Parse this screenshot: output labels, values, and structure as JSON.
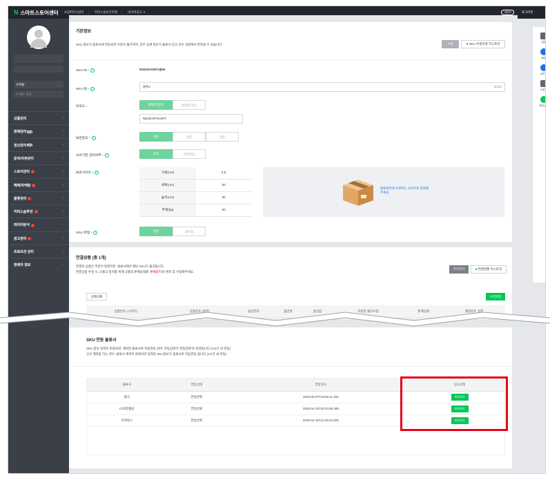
{
  "topbar": {
    "logo": "N",
    "title": "스마트스토어센터",
    "nav": [
      "쇼핑파트너센터",
      "커머스솔루션마켓",
      "네이버광고"
    ],
    "nav_suffix": "▾",
    "user_badge": "내정보",
    "logout": "로그아웃"
  },
  "sidebar": {
    "store_select": "수퍼왕",
    "search_placeholder": "메뉴 검색",
    "items": [
      {
        "label": "상품관리"
      },
      {
        "label": "판매관리",
        "badge": "pay"
      },
      {
        "label": "정산관리",
        "badge": "pay"
      },
      {
        "label": "문의/리뷰관리"
      },
      {
        "label": "스토어관리",
        "new": true
      },
      {
        "label": "혜택/마케팅",
        "new": true
      },
      {
        "label": "물류관리",
        "new": true
      },
      {
        "label": "커머스솔루션",
        "new": true
      },
      {
        "label": "데이터분석",
        "new": true
      },
      {
        "label": "광고관리",
        "new": true
      },
      {
        "label": "프로모션 관리"
      },
      {
        "label": "판매자 정보"
      }
    ],
    "pay_text": "pay"
  },
  "basic": {
    "title": "기본정보",
    "desc": "SKU 정보가 물류사에 연동되면 수정이 불가하며, 일부 상세 정보가 물류사 입고 검수 과정에서 변경될 수 있습니다.",
    "btn_edit": "수정",
    "btn_history": "SKU 수정이력 히스토리",
    "sku_id_label": "SKU ID",
    "sku_id_value": "N31GKXWVJjbN",
    "sku_name_label": "SKU 명",
    "sku_name_value": "블루J",
    "sku_name_count": "2/150",
    "barcode_label": "바코드",
    "barcode_tabs": [
      "판매자 입력",
      "네이버 자동"
    ],
    "barcode_value": "NB1bcOFmxnRT",
    "storage_label": "보관온도",
    "storage_opts": [
      "상온",
      "냉장",
      "냉동"
    ],
    "expiry_label": "소비기한 관리여부",
    "expiry_opts": [
      "관리",
      "관리안함"
    ],
    "size_label": "보관사이즈",
    "dims": [
      {
        "label": "가로(cm)",
        "value": "2.5"
      },
      {
        "label": "세로(cm)",
        "value": "30"
      },
      {
        "label": "높이(cm)",
        "value": "30"
      },
      {
        "label": "무게(kg)",
        "value": "30"
      }
    ],
    "box_text": "물류센터에 보관하는 사이즈로 입력해 주세요.",
    "sku_type_label": "SKU 유형",
    "sku_type_opts": [
      "일반",
      "세트형"
    ],
    "required_mark": "•"
  },
  "linked": {
    "title": "연결상품 (총 1개)",
    "desc1": "연결된 상품은 주문이 발생하면, 물류사에서 해당 SKU가 출고됩니다.",
    "desc2_prefix": "연결상품 수정 시, 오출고 방지를 위해 상품의 판매상태를",
    "desc2_hl": "'판매중지'",
    "desc2_suffix": "로 변경 후 수정해주세요.",
    "btn_add": "추가하기",
    "btn_history": "연결현황 히스토리",
    "btn_delete": "선택삭제",
    "btn_excel": "수정저장",
    "columns": [
      "",
      "상품번호 (스마트)",
      "상품번호 (원부)",
      "옵션번호",
      "옵션명",
      "옵션값",
      "수량당 출고수량",
      "판매상태",
      "통합한도 설정"
    ]
  },
  "logistics": {
    "title": "SKU 연동 물류사",
    "desc1": "SKU 정보 입력이 완료되면, 계약된 물류사로 자동연동 되며, 연동상태가 '연동완료'로 변경됩니다 (1시간 내 연동)",
    "desc2": "신규 계약을 하는 경우, 물류사 계약이 완료되면 입력된 SKU정보가 물류사로 자동연동 됩니다 (1시간 내 연동)",
    "columns": [
      "물류사",
      "연동상태",
      "연동일시",
      "입고신청"
    ],
    "rows": [
      {
        "name": "풀고",
        "status": "연동완료",
        "date": "2025-05-07T18:55:11.204",
        "action": "바로가기"
      },
      {
        "name": "CJ대한통운",
        "status": "연동완료",
        "date": "2025-04-15T18:40:59.488",
        "action": "바로가기"
      },
      {
        "name": "아워박스",
        "status": "연동완료",
        "date": "2025-04-18T12:48:04.505",
        "action": "바로가기"
      }
    ]
  },
  "rightbar": {
    "items": [
      "알림",
      "할일",
      "솔루션",
      "도움말",
      "톡톡상담"
    ]
  },
  "colors": {
    "brand": "#03c75a",
    "highlight": "#e60012",
    "topbar": "#22252b",
    "sidebar": "#3b3f47"
  }
}
